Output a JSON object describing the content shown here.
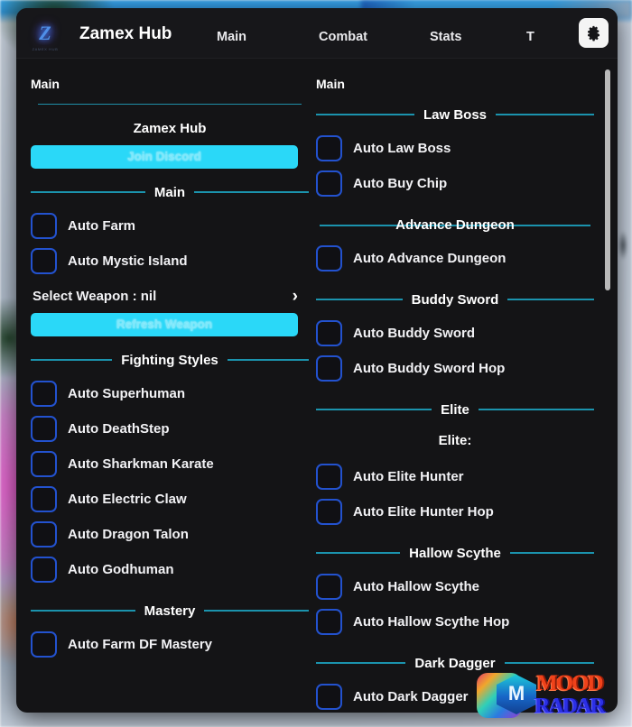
{
  "titlebar": {
    "logo_mark": "Z",
    "logo_sub": "ZAMEX HUB",
    "app_title": "Zamex Hub",
    "tabs": [
      {
        "label": "Main"
      },
      {
        "label": "Combat"
      },
      {
        "label": "Stats"
      },
      {
        "label": "T"
      }
    ],
    "settings_icon": "gear-icon"
  },
  "colors": {
    "accent_cyan": "#2ad8f8",
    "divider_teal": "#1b93ad",
    "checkbox_blue": "#2352cf",
    "panel_bg": "#141416",
    "titlebar_bg": "#17171a",
    "scrollbar": "#b9b9b9"
  },
  "left_panel": {
    "tab_label": "Main",
    "brand_title": "Zamex Hub",
    "discord_button": "Join Discord",
    "section_main": "Main",
    "items": [
      {
        "label": "Auto Farm",
        "checked": false
      },
      {
        "label": "Auto Mystic Island",
        "checked": false
      }
    ],
    "weapon_dropdown": {
      "label": "Select Weapon : nil",
      "chevron": "chevron-right-icon"
    },
    "refresh_button": "Refresh Weapon",
    "section_fighting_styles": "Fighting Styles",
    "fighting_styles": [
      {
        "label": "Auto Superhuman",
        "checked": false
      },
      {
        "label": "Auto DeathStep",
        "checked": false
      },
      {
        "label": "Auto Sharkman Karate",
        "checked": false
      },
      {
        "label": "Auto Electric Claw",
        "checked": false
      },
      {
        "label": "Auto Dragon Talon",
        "checked": false
      },
      {
        "label": "Auto Godhuman",
        "checked": false
      }
    ],
    "section_mastery": "Mastery",
    "mastery": [
      {
        "label": "Auto Farm DF Mastery",
        "checked": false
      }
    ]
  },
  "right_panel": {
    "tab_label": "Main",
    "section_law_boss": "Law Boss",
    "law_boss": [
      {
        "label": "Auto Law Boss",
        "checked": false
      },
      {
        "label": "Auto Buy Chip",
        "checked": false
      }
    ],
    "section_advance_dungeon": "Advance Dungeon",
    "advance_dungeon": [
      {
        "label": "Auto Advance Dungeon",
        "checked": false
      }
    ],
    "section_buddy_sword": "Buddy Sword",
    "buddy_sword": [
      {
        "label": "Auto Buddy Sword",
        "checked": false
      },
      {
        "label": "Auto Buddy Sword Hop",
        "checked": false
      }
    ],
    "section_elite": "Elite",
    "elite_sublabel": "Elite:",
    "elite": [
      {
        "label": "Auto Elite Hunter",
        "checked": false
      },
      {
        "label": "Auto Elite Hunter Hop",
        "checked": false
      }
    ],
    "section_hallow_scythe": "Hallow Scythe",
    "hallow_scythe": [
      {
        "label": "Auto Hallow Scythe",
        "checked": false
      },
      {
        "label": "Auto Hallow Scythe Hop",
        "checked": false
      }
    ],
    "section_dark_dagger": "Dark Dagger",
    "dark_dagger": [
      {
        "label": "Auto Dark Dagger",
        "checked": false
      }
    ]
  },
  "watermark": {
    "line1": "MOOD",
    "line2": "RADAR",
    "icon": "roblox-app-icon",
    "badge": "mood-radar-logo-icon"
  }
}
